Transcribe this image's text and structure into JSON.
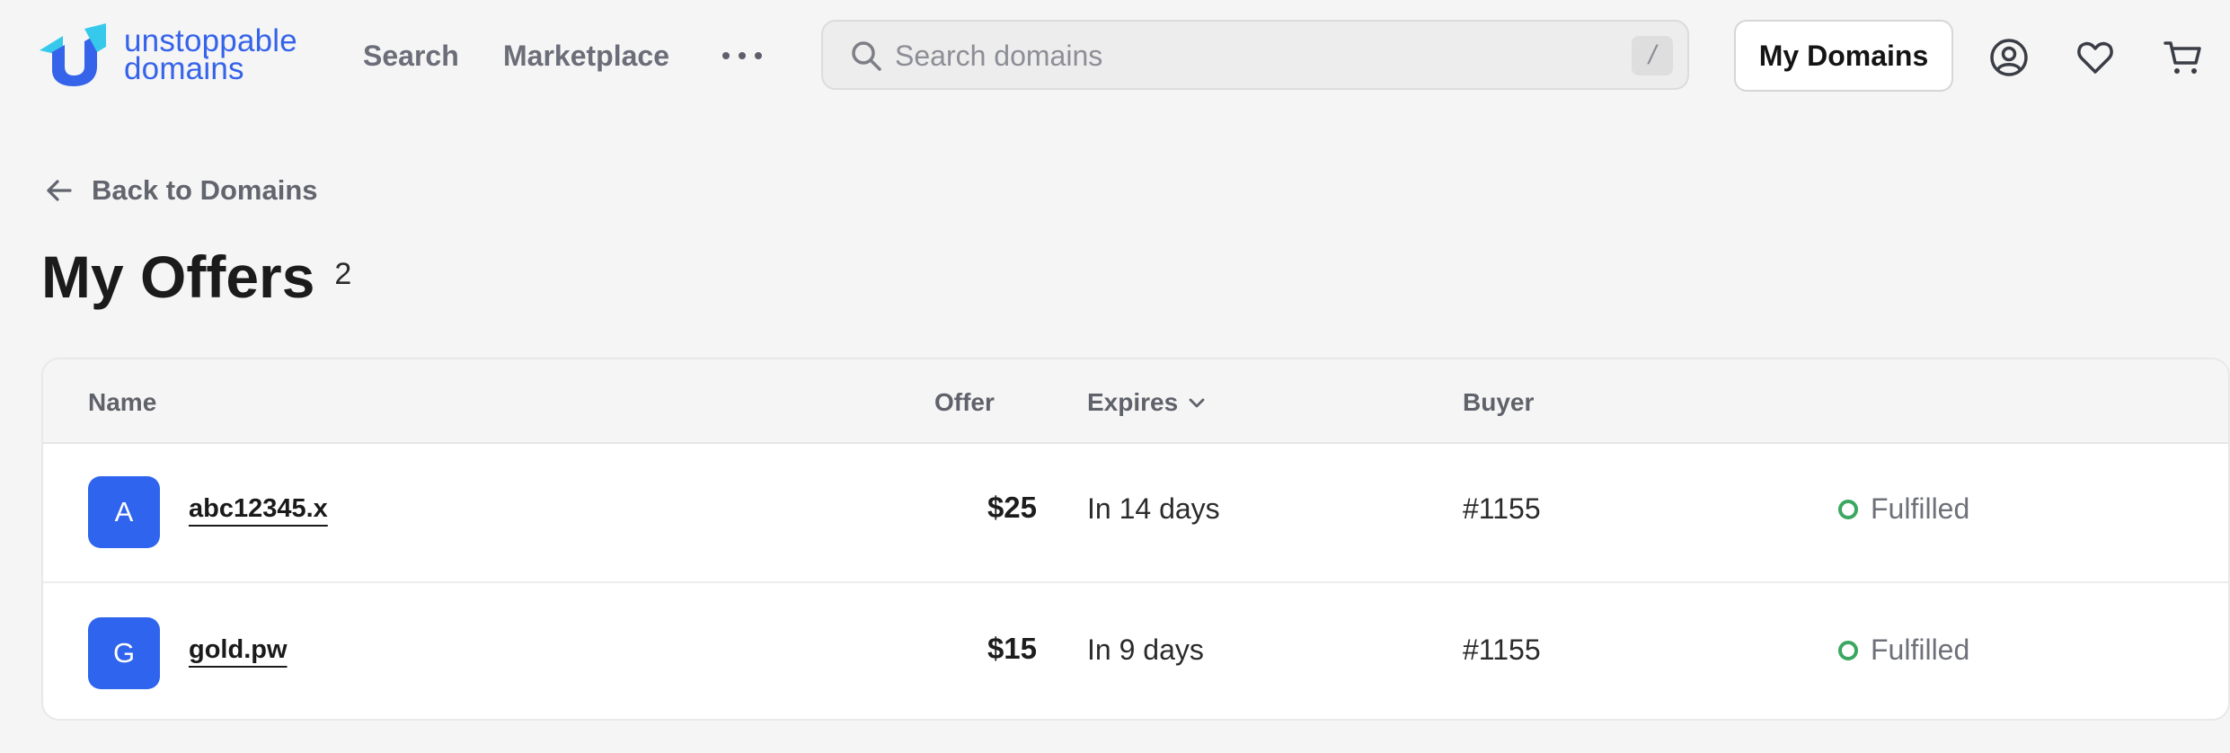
{
  "brand": {
    "line1": "unstoppable",
    "line2": "domains",
    "color": "#3563e9"
  },
  "nav": {
    "search_label": "Search",
    "marketplace_label": "Marketplace"
  },
  "search": {
    "placeholder": "Search domains",
    "shortcut": "/"
  },
  "header": {
    "my_domains_label": "My Domains"
  },
  "icons": {
    "more": "more-dots-icon",
    "search": "search-icon",
    "profile": "user-circle-icon",
    "favorites": "heart-icon",
    "cart": "cart-icon",
    "back": "arrow-left-icon",
    "sort": "chevron-down-icon",
    "status": "status-dot-icon"
  },
  "back_link": {
    "label": "Back to Domains"
  },
  "page": {
    "title": "My Offers",
    "count": "2"
  },
  "table": {
    "columns": {
      "name": "Name",
      "offer": "Offer",
      "expires": "Expires",
      "buyer": "Buyer"
    },
    "rows": [
      {
        "initial": "A",
        "domain": "abc12345.x",
        "offer": "$25",
        "expires": "In 14 days",
        "buyer": "#1155",
        "status": "Fulfilled"
      },
      {
        "initial": "G",
        "domain": "gold.pw",
        "offer": "$15",
        "expires": "In 9 days",
        "buyer": "#1155",
        "status": "Fulfilled"
      }
    ]
  },
  "colors": {
    "accent": "#2f64ee",
    "status_fulfilled": "#3ba761",
    "background": "#f5f5f5"
  }
}
